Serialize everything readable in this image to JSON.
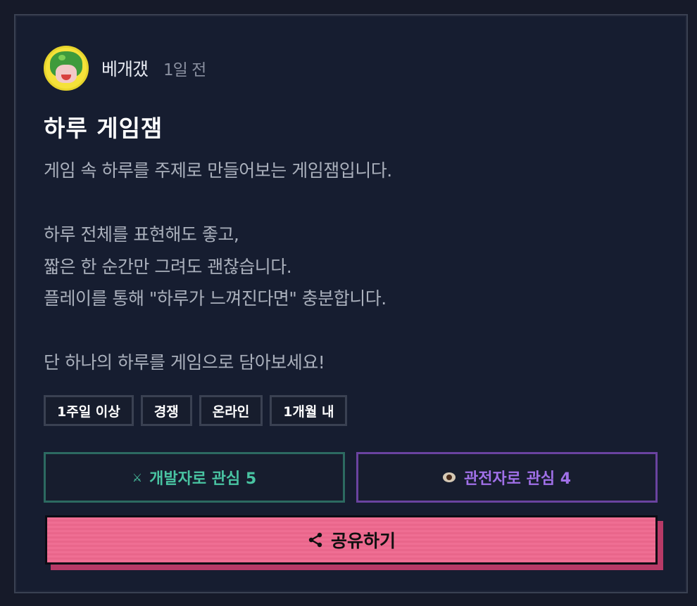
{
  "post": {
    "author": "베개갰",
    "time": "1일 전",
    "title": "하루 게임잼",
    "description_lines": [
      "게임 속 하루를 주제로 만들어보는 게임잼입니다.",
      "",
      "하루 전체를 표현해도 좋고,",
      "짧은 한 순간만 그려도 괜찮습니다.",
      "플레이를 통해 \"하루가 느껴진다면\" 충분합니다.",
      "",
      "단 하나의 하루를 게임으로 담아보세요!"
    ],
    "tags": [
      "1주일 이상",
      "경쟁",
      "온라인",
      "1개월 내"
    ]
  },
  "interest": {
    "developer_icon": "crossed-swords-icon",
    "developer_label": "개발자로 관심 5",
    "viewer_icon": "eye-icon",
    "viewer_label": "관전자로 관심 4"
  },
  "share": {
    "icon": "share-icon",
    "label": "공유하기"
  },
  "colors": {
    "background": "#161d30",
    "developer_accent": "#49c4a2",
    "viewer_accent": "#a070e8",
    "share_button": "#ef6e93"
  }
}
